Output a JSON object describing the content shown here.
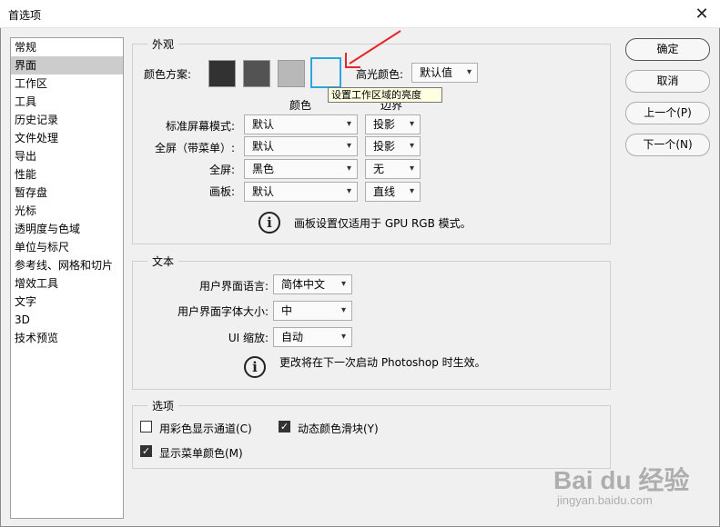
{
  "window": {
    "title": "首选项",
    "close_glyph": "✕"
  },
  "sidebar": {
    "items": [
      {
        "label": "常规",
        "selected": false
      },
      {
        "label": "界面",
        "selected": true
      },
      {
        "label": "工作区",
        "selected": false
      },
      {
        "label": "工具",
        "selected": false
      },
      {
        "label": "历史记录",
        "selected": false
      },
      {
        "label": "文件处理",
        "selected": false
      },
      {
        "label": "导出",
        "selected": false
      },
      {
        "label": "性能",
        "selected": false
      },
      {
        "label": "暂存盘",
        "selected": false
      },
      {
        "label": "光标",
        "selected": false
      },
      {
        "label": "透明度与色域",
        "selected": false
      },
      {
        "label": "单位与标尺",
        "selected": false
      },
      {
        "label": "参考线、网格和切片",
        "selected": false
      },
      {
        "label": "增效工具",
        "selected": false
      },
      {
        "label": "文字",
        "selected": false
      },
      {
        "label": "3D",
        "selected": false
      },
      {
        "label": "技术预览",
        "selected": false
      }
    ]
  },
  "appearance": {
    "legend": "外观",
    "color_scheme_label": "颜色方案:",
    "swatches": [
      {
        "color": "#323232",
        "selected": false
      },
      {
        "color": "#535353",
        "selected": false
      },
      {
        "color": "#b8b8b8",
        "selected": false
      },
      {
        "color": "#f0f0f0",
        "selected": true
      }
    ],
    "highlight_label": "高光颜色:",
    "highlight_value": "默认值",
    "tooltip": "设置工作区域的亮度",
    "col_color": "颜色",
    "col_border": "边界",
    "rows": [
      {
        "label": "标准屏幕模式:",
        "color": "默认",
        "border": "投影"
      },
      {
        "label": "全屏（带菜单）:",
        "color": "默认",
        "border": "投影"
      },
      {
        "label": "全屏:",
        "color": "黑色",
        "border": "无"
      },
      {
        "label": "画板:",
        "color": "默认",
        "border": "直线"
      }
    ],
    "info_text": "画板设置仅适用于 GPU RGB 模式。"
  },
  "text_section": {
    "legend": "文本",
    "language_label": "用户界面语言:",
    "language_value": "简体中文",
    "fontsize_label": "用户界面字体大小:",
    "fontsize_value": "中",
    "scale_label": "UI 缩放:",
    "scale_value": "自动",
    "info_text": "更改将在下一次启动 Photoshop 时生效。"
  },
  "options": {
    "legend": "选项",
    "color_channels": {
      "label": "用彩色显示通道(C)",
      "checked": false
    },
    "dynamic_sliders": {
      "label": "动态颜色滑块(Y)",
      "checked": true
    },
    "menu_colors": {
      "label": "显示菜单颜色(M)",
      "checked": true
    }
  },
  "buttons": {
    "ok": "确定",
    "cancel": "取消",
    "prev": "上一个(P)",
    "next": "下一个(N)"
  },
  "watermark": {
    "main": "Bai du 经验",
    "sub": "jingyan.baidu.com"
  },
  "icons": {
    "info": "info-icon",
    "caret": "▾",
    "check": "✓",
    "close": "close-icon"
  },
  "colors": {
    "selected_swatch_border": "#2aa6e0",
    "annotation_arrow": "#e8252b",
    "tooltip_bg": "#ffffe1"
  }
}
